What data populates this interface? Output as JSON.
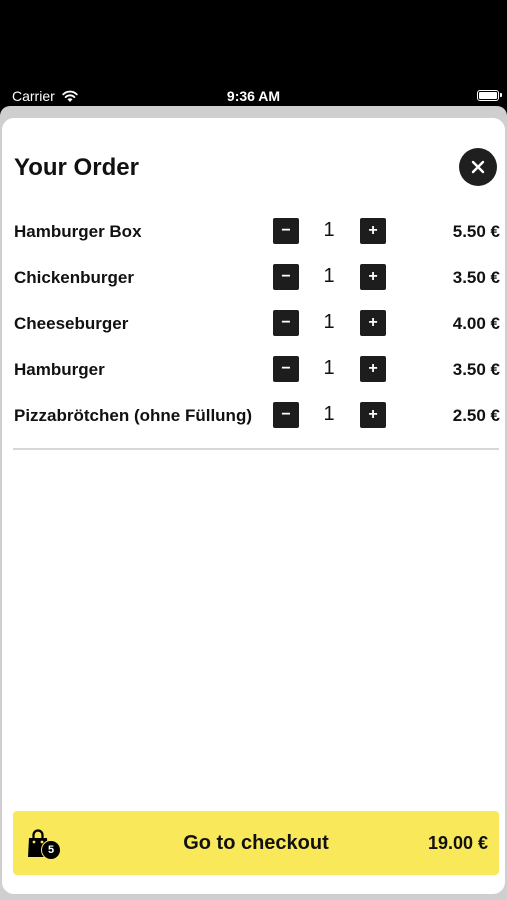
{
  "status": {
    "carrier": "Carrier",
    "time": "9:36 AM"
  },
  "header": {
    "title": "Your Order"
  },
  "items": [
    {
      "name": "Hamburger Box",
      "qty": "1",
      "price": "5.50 €"
    },
    {
      "name": "Chickenburger",
      "qty": "1",
      "price": "3.50 €"
    },
    {
      "name": "Cheeseburger",
      "qty": "1",
      "price": "4.00 €"
    },
    {
      "name": "Hamburger",
      "qty": "1",
      "price": "3.50 €"
    },
    {
      "name": "Pizzabrötchen (ohne Füllung)",
      "qty": "1",
      "price": "2.50 €"
    }
  ],
  "buttons": {
    "minus": "−",
    "plus": "+"
  },
  "checkout": {
    "label": "Go to checkout",
    "total": "19.00 €",
    "count": "5"
  },
  "colors": {
    "accent": "#f8e85a",
    "dark": "#1d1d1d"
  },
  "icons": [
    "wifi-icon",
    "battery-icon",
    "close-icon",
    "minus-icon",
    "plus-icon",
    "shopping-bag-icon"
  ]
}
